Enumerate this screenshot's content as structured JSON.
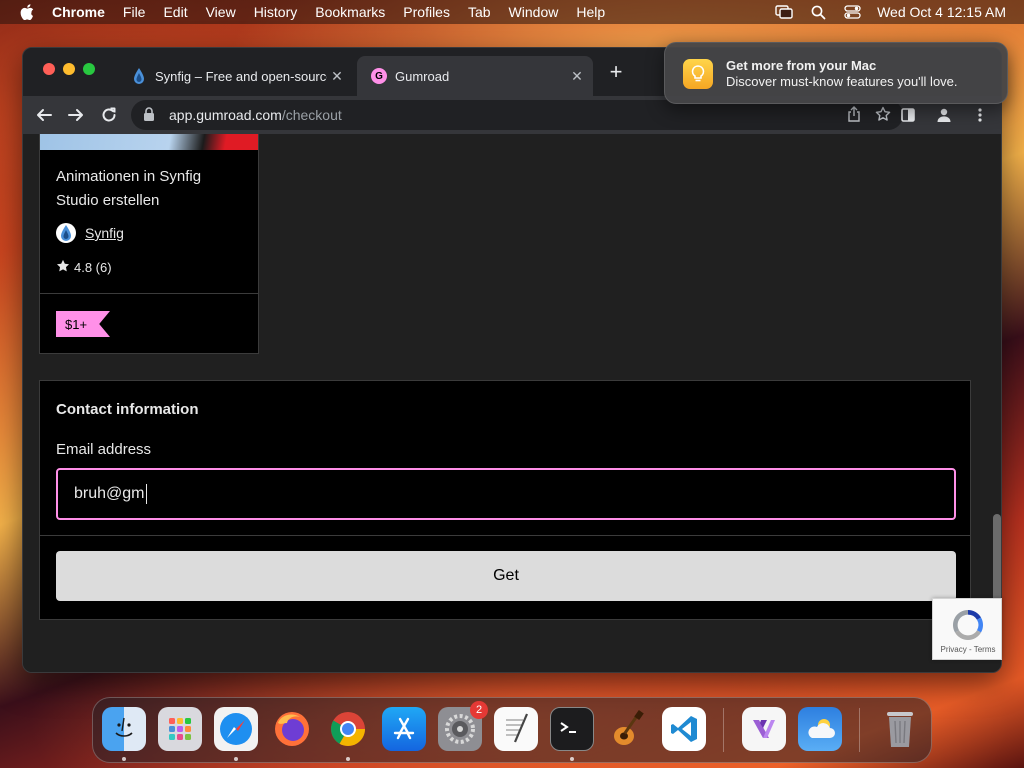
{
  "menubar": {
    "app_name": "Chrome",
    "items": [
      "File",
      "Edit",
      "View",
      "History",
      "Bookmarks",
      "Profiles",
      "Tab",
      "Window",
      "Help"
    ],
    "datetime": "Wed Oct 4  12:15 AM"
  },
  "browser": {
    "tabs": [
      {
        "title": "Synfig – Free and open-source",
        "favicon": "synfig-icon",
        "active": false
      },
      {
        "title": "Gumroad",
        "favicon": "gumroad-icon",
        "active": true
      }
    ],
    "url_host": "app.gumroad.com",
    "url_path": "/checkout"
  },
  "product": {
    "title": "Animationen in Synfig Studio erstellen",
    "creator": "Synfig",
    "rating": "4.8 (6)",
    "price": "$1+"
  },
  "contact": {
    "heading": "Contact information",
    "email_label": "Email address",
    "email_value": "bruh@gm"
  },
  "checkout": {
    "get_label": "Get"
  },
  "recaptcha": {
    "links": "Privacy - Terms"
  },
  "notification": {
    "title": "Get more from your Mac",
    "body": "Discover must-know features you'll love."
  },
  "dock": {
    "settings_badge": "2",
    "apps": [
      "finder-icon",
      "launchpad-icon",
      "safari-icon",
      "firefox-icon",
      "chrome-icon",
      "app-store-icon",
      "system-settings-icon",
      "textedit-icon",
      "terminal-icon",
      "garageband-icon",
      "vscode-icon",
      "visual-studio-icon",
      "weather-icon",
      "trash-icon"
    ]
  },
  "colors": {
    "accent_pink": "#ff90e8",
    "page_bg": "#202020",
    "button_bg": "#dcdcdc"
  }
}
